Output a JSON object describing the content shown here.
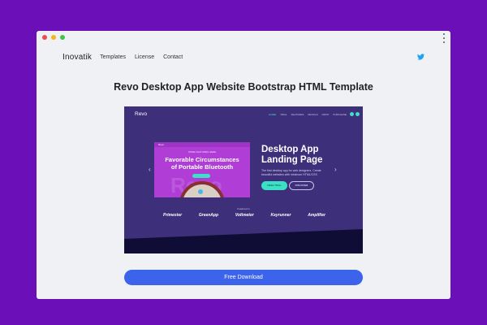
{
  "nav": {
    "brand": "Inovatik",
    "links": [
      "Templates",
      "License",
      "Contact"
    ]
  },
  "page": {
    "title": "Revo Desktop App Website Bootstrap HTML Template",
    "download_label": "Free Download"
  },
  "preview": {
    "logo": "Revo",
    "menu": [
      "HOME",
      "TRIAL",
      "FEATURES",
      "DETAILS",
      "DROP",
      "PURCHASE"
    ],
    "card_brand": "Revo",
    "card_small": "SOME FEATURES HERE",
    "card_title_line1": "Favorable Circumstances",
    "card_title_line2": "of Portable Bluetooth",
    "ghost": "Revo",
    "headline_line1": "Desktop App",
    "headline_line2": "Landing Page",
    "description": "The first desktop app for web designers. Create beautiful websites with minimum HTML/CSS",
    "button_primary": "FREE TRIAL",
    "button_secondary": "DISCOVER",
    "featured": "Featured in",
    "logos": [
      "Primester",
      "GreenApp",
      "Voltmeter",
      "Keyrunner",
      "Amplifier"
    ]
  },
  "colors": {
    "background": "#6b0fb8",
    "window": "#eff1f4",
    "accent": "#3b63ec",
    "preview_bg": "#3d2f79",
    "preview_accent": "#3ce0c5"
  },
  "icons": {
    "social": "twitter-icon",
    "menu": "kebab-menu-icon"
  }
}
